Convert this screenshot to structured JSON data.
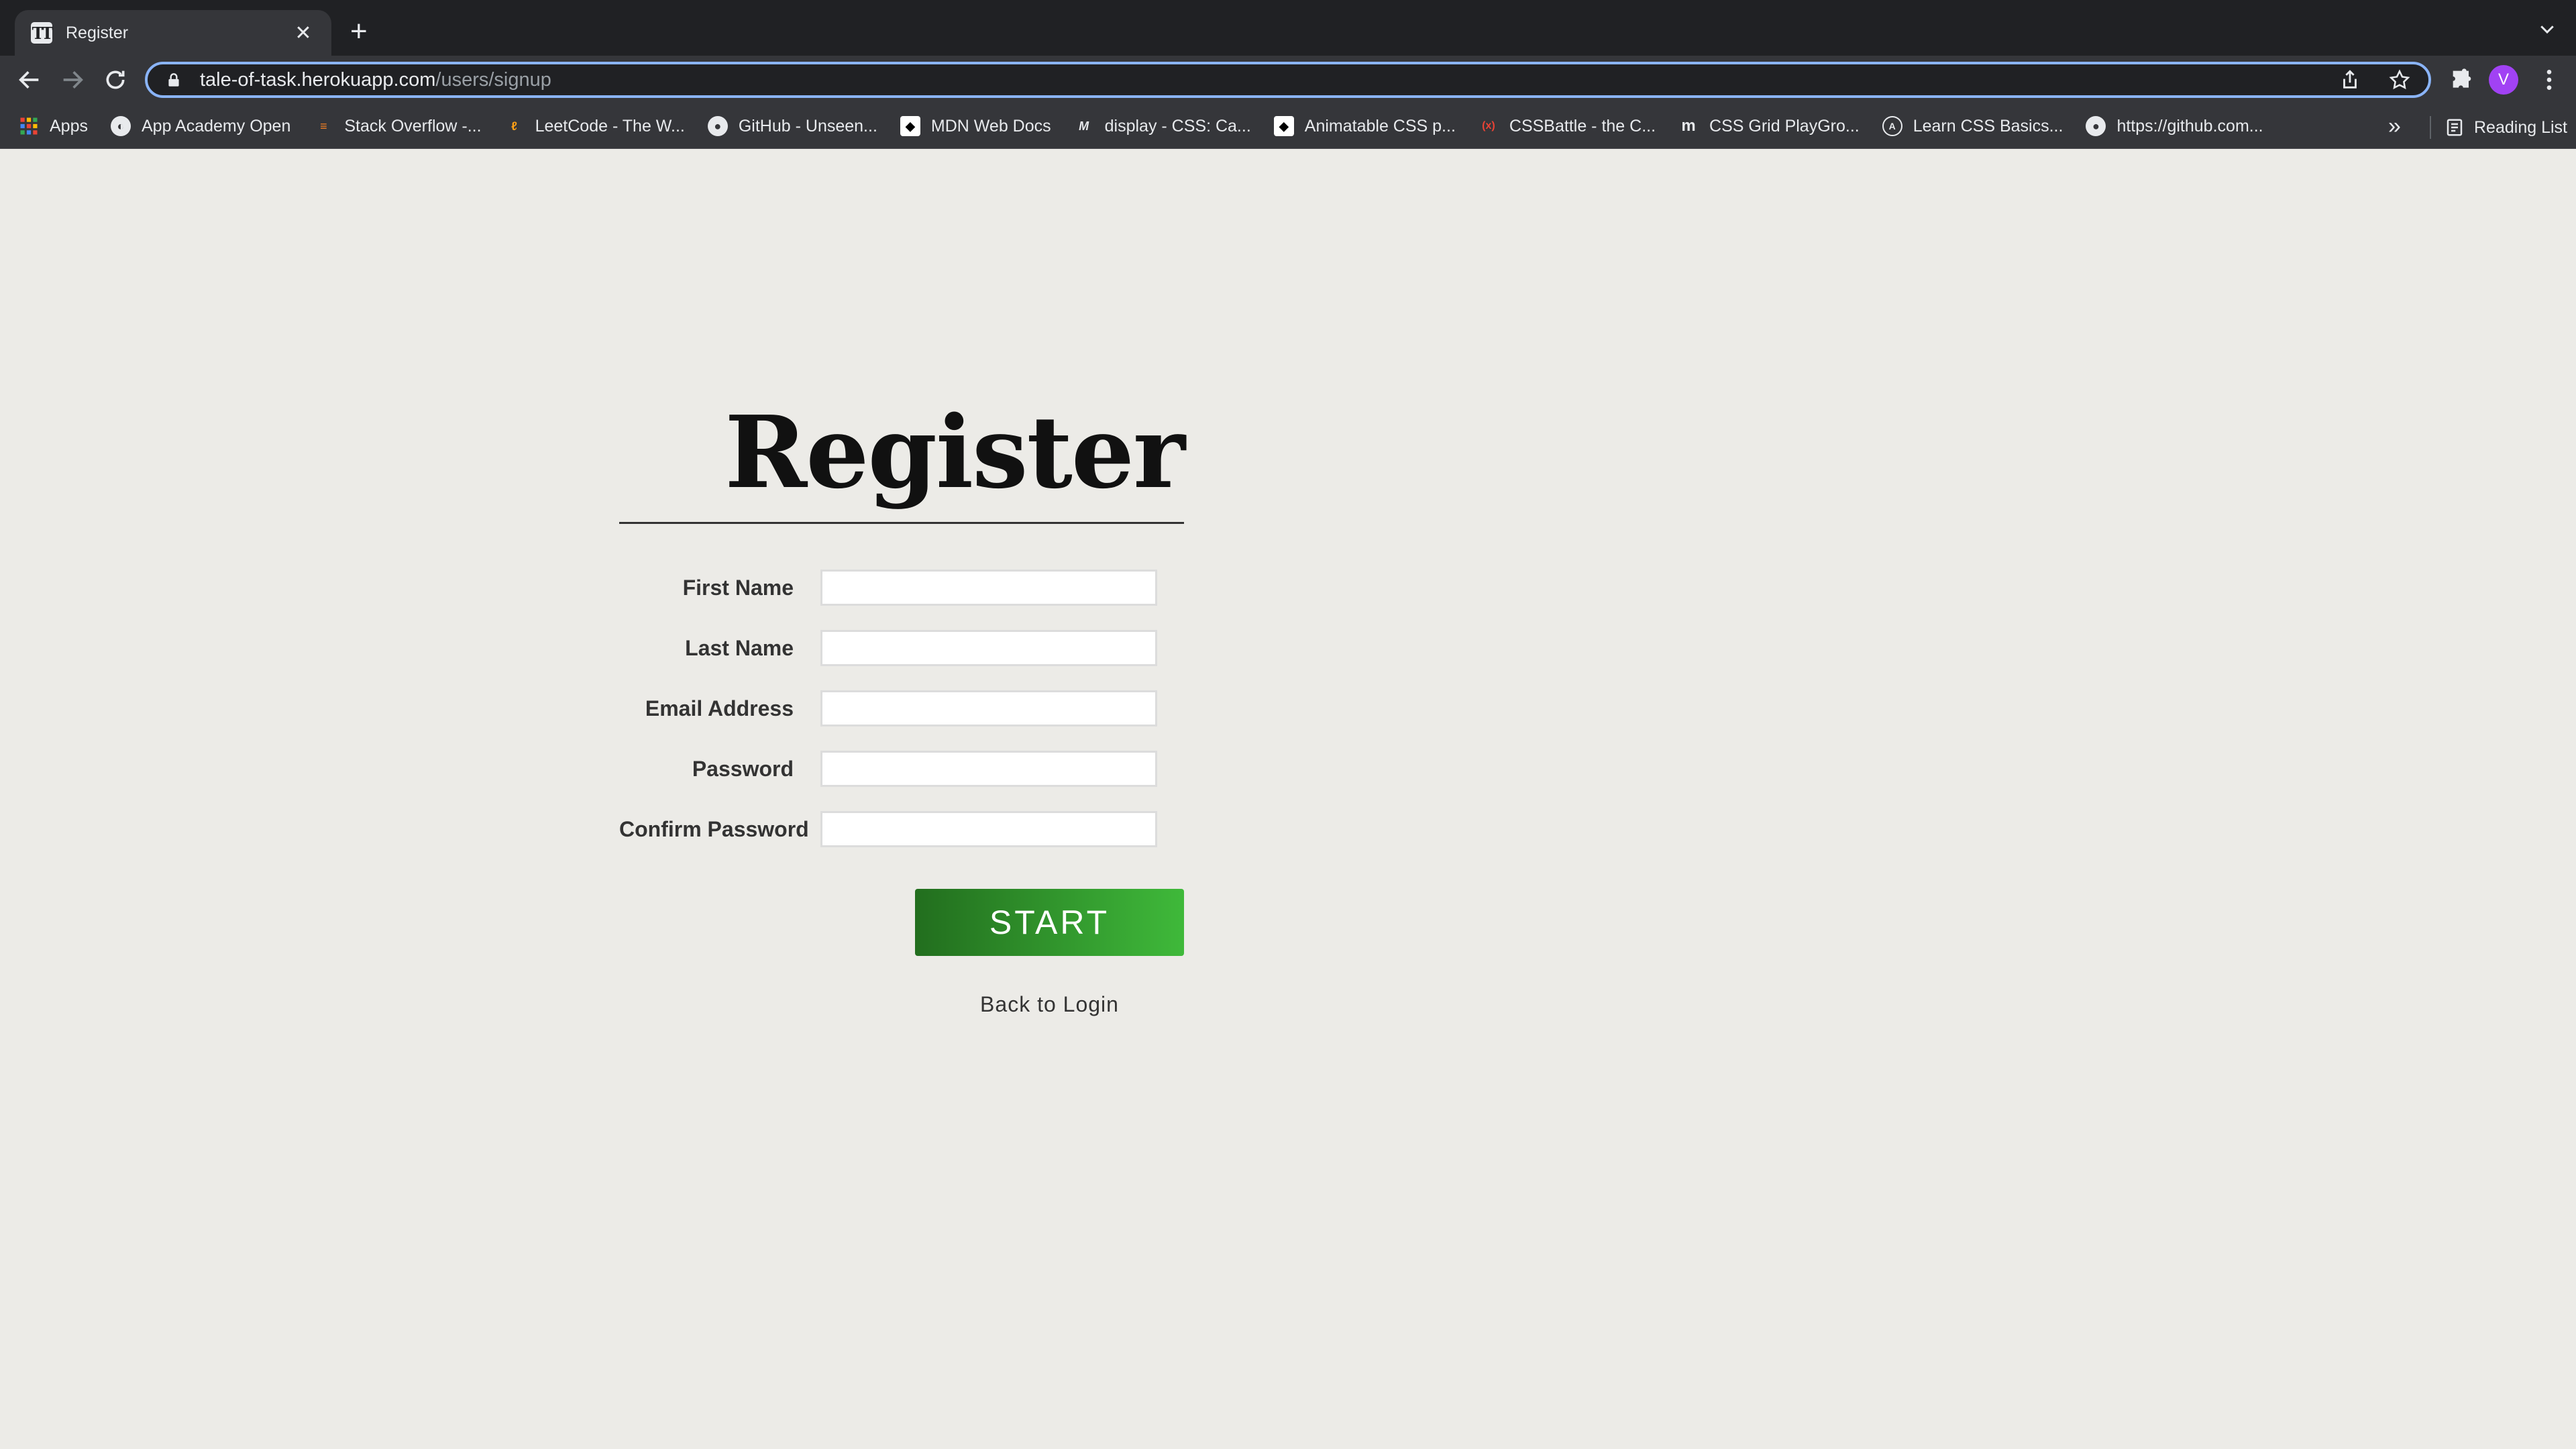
{
  "browser": {
    "tab": {
      "title": "Register",
      "favicon": "task-logo-icon"
    },
    "address_bar": {
      "host": "tale-of-task.herokuapp.com",
      "path": "/users/signup"
    },
    "profile_initial": "V",
    "bookmarks": [
      {
        "label": "Apps",
        "icon": "apps-grid-icon",
        "color": "#ea4335"
      },
      {
        "label": "App Academy Open",
        "icon": "app-academy-icon",
        "color": "#ffffff"
      },
      {
        "label": "Stack Overflow -...",
        "icon": "stack-overflow-icon",
        "color": "#f48024"
      },
      {
        "label": "LeetCode - The W...",
        "icon": "leetcode-icon",
        "color": "#ffa116"
      },
      {
        "label": "GitHub - Unseen...",
        "icon": "github-icon",
        "color": "#ffffff"
      },
      {
        "label": "MDN Web Docs",
        "icon": "mdn-icon",
        "color": "#ffffff"
      },
      {
        "label": "display - CSS: Ca...",
        "icon": "mdn-m-icon",
        "color": "#ffffff"
      },
      {
        "label": "Animatable CSS p...",
        "icon": "mdn-icon",
        "color": "#ffffff"
      },
      {
        "label": "CSSBattle - the C...",
        "icon": "cssbattle-icon",
        "color": "#ea4335"
      },
      {
        "label": "CSS Grid PlayGro...",
        "icon": "mozilla-m-icon",
        "color": "#ffffff"
      },
      {
        "label": "Learn CSS Basics...",
        "icon": "learn-css-icon",
        "color": "#ffffff"
      },
      {
        "label": "https://github.com...",
        "icon": "github-icon",
        "color": "#ffffff"
      }
    ],
    "more_bookmarks": "»",
    "reading_list": "Reading List"
  },
  "page": {
    "title": "Register",
    "fields": [
      {
        "label": "First Name",
        "value": "",
        "type": "text"
      },
      {
        "label": "Last Name",
        "value": "",
        "type": "text"
      },
      {
        "label": "Email Address",
        "value": "",
        "type": "email"
      },
      {
        "label": "Password",
        "value": "",
        "type": "password"
      },
      {
        "label": "Confirm Password",
        "value": "",
        "type": "password"
      }
    ],
    "submit_label": "START",
    "back_link": "Back to Login",
    "accent_color": "#2f9e2a"
  }
}
